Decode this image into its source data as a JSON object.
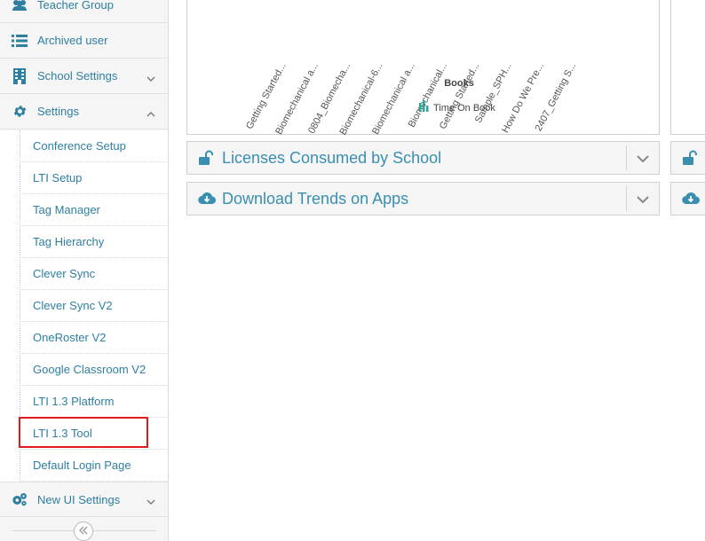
{
  "sidebar": {
    "items": [
      {
        "label": "Teacher Group",
        "icon": "users-icon"
      },
      {
        "label": "Archived user",
        "icon": "list-icon"
      },
      {
        "label": "School Settings",
        "icon": "building-icon"
      },
      {
        "label": "Settings",
        "icon": "gear-icon"
      },
      {
        "label": "New UI Settings",
        "icon": "gears-icon"
      }
    ],
    "settings_sub_items": [
      "Conference Setup",
      "LTI Setup",
      "Tag Manager",
      "Tag Hierarchy",
      "Clever Sync",
      "Clever Sync V2",
      "OneRoster V2",
      "Google Classroom V2",
      "LTI 1.3 Platform",
      "LTI 1.3 Tool",
      "Default Login Page"
    ],
    "highlighted_item": "LTI 1.3 Tool"
  },
  "chart_data": {
    "type": "bar",
    "categories": [
      "Getting Started...",
      "Biomechanical a...",
      "0804_Biomecha...",
      "Biomechanical-6...",
      "Biomechanical a...",
      "Biomechanical...",
      "Getting Started...",
      "Sample_SPH...",
      "How Do We Pre...",
      "2407_Getting S..."
    ],
    "xlabel": "Books",
    "legend": "Time On Book",
    "legend_color": "#2ca89a"
  },
  "panels": [
    {
      "title": "Licenses Consumed by School",
      "icon": "unlock-icon"
    },
    {
      "title": "Download Trends on Apps",
      "icon": "cloud-download-icon"
    }
  ],
  "colors": {
    "accent": "#2e7fa0",
    "highlight": "#e01b1b"
  }
}
